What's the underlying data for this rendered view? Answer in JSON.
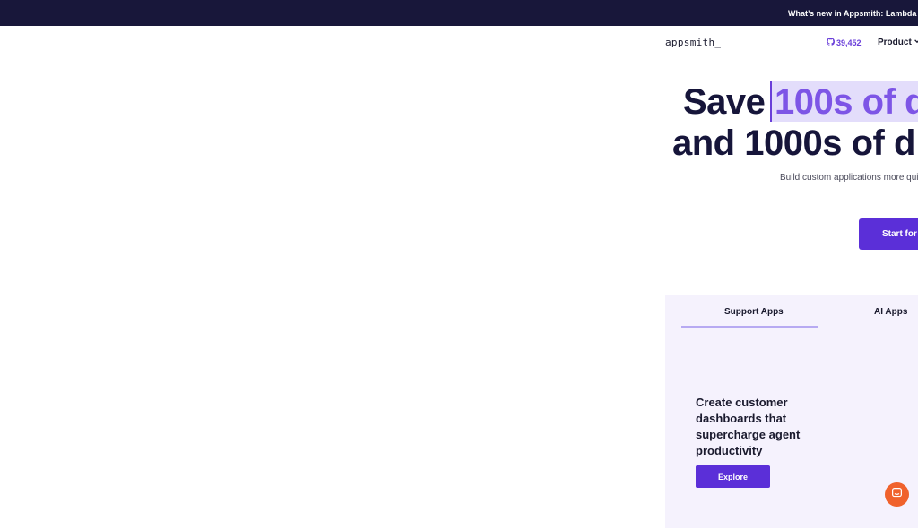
{
  "announcement": {
    "text": "What’s new in Appsmith: Lambda impro"
  },
  "nav": {
    "logo": "appsmith_",
    "github_stars": "39,452",
    "product_label": "Product"
  },
  "hero": {
    "line1_prefix": "Save ",
    "line1_highlight": "100s of d",
    "line2": "and 1000s of d",
    "subtitle": "Build custom applications more quic",
    "cta_label": "Start for f"
  },
  "showcase": {
    "tabs": [
      {
        "label": "Support Apps",
        "active": true
      },
      {
        "label": "AI Apps",
        "active": false
      }
    ],
    "card_heading": "Create customer dashboards that supercharge agent productivity",
    "explore_label": "Explore"
  },
  "colors": {
    "announce_bg": "#18173a",
    "brand_purple": "#5b2fd8",
    "highlight_bg": "#e3ddfb",
    "highlight_text": "#7d55e6",
    "chat_orange": "#f0622c"
  },
  "icons": {
    "github": "github-icon",
    "chevron": "chevron-down-icon",
    "chat": "chat-icon"
  }
}
